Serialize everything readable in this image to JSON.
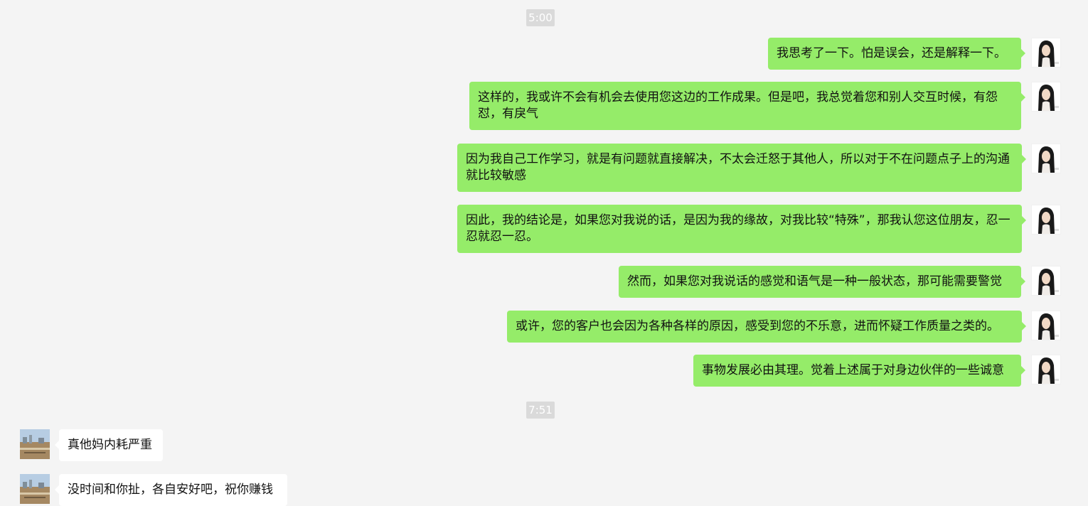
{
  "timestamps": [
    "5:00",
    "7:51"
  ],
  "messages": [
    {
      "side": "me",
      "text": "我思考了一下。怕是误会，还是解释一下。"
    },
    {
      "side": "me",
      "text": "这样的，我或许不会有机会去使用您这边的工作成果。但是吧，我总觉着您和别人交互时候，有怨怼，有戾气"
    },
    {
      "side": "me",
      "text": "因为我自己工作学习，就是有问题就直接解决，不太会迁怒于其他人，所以对于不在问题点子上的沟通就比较敏感"
    },
    {
      "side": "me",
      "text": "因此，我的结论是，如果您对我说的话，是因为我的缘故，对我比较“特殊”，那我认您这位朋友，忍一忍就忍一忍。"
    },
    {
      "side": "me",
      "text": "然而，如果您对我说话的感觉和语气是一种一般状态，那可能需要警觉"
    },
    {
      "side": "me",
      "text": "或许，您的客户也会因为各种各样的原因，感受到您的不乐意，进而怀疑工作质量之类的。"
    },
    {
      "side": "me",
      "text": "事物发展必由其理。觉着上述属于对身边伙伴的一些诚意"
    },
    {
      "side": "them",
      "text": "真他妈内耗严重"
    },
    {
      "side": "them",
      "text": "没时间和你扯，各自安好吧，祝你赚钱"
    }
  ],
  "avatars": {
    "me": "user-avatar-girl-photo",
    "them": "contact-avatar-landscape-photo"
  },
  "colors": {
    "background": "#f4f4f4",
    "my_bubble": "#95ec69",
    "their_bubble": "#ffffff",
    "timestamp_bg": "#dadada"
  }
}
